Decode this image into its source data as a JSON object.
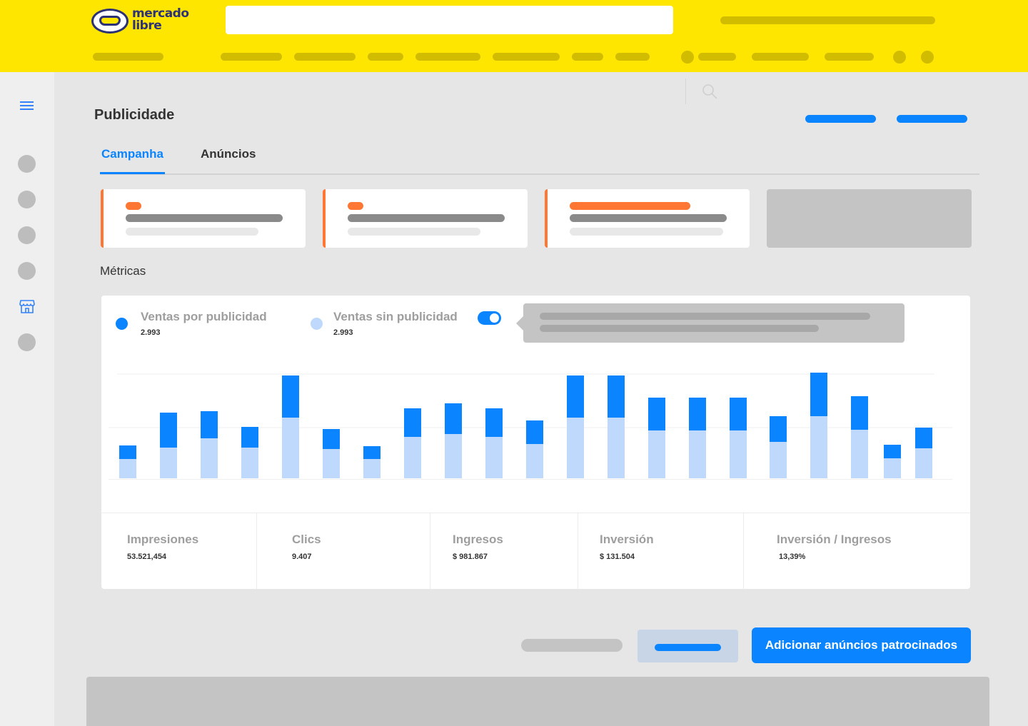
{
  "colors": {
    "brand_yellow": "#ffe600",
    "accent_blue": "#0a84ff",
    "light_blue": "#bfd9fc",
    "orange": "#ff7733",
    "placeholder_gray": "#c4c4c4"
  },
  "header": {
    "logo_text_line1": "mercado",
    "logo_text_line2": "libre",
    "logo_icon": "handshake-icon",
    "search": {
      "value": "",
      "placeholder": ""
    }
  },
  "sidebar": {
    "menu_icon": "menu-icon",
    "store_icon": "store-icon"
  },
  "page": {
    "title": "Publicidade",
    "search_icon": "search-icon"
  },
  "tabs": [
    {
      "label": "Campanha",
      "active": true
    },
    {
      "label": "Anúncios",
      "active": false
    }
  ],
  "metrics_section": {
    "label": "Métricas",
    "legend": [
      {
        "name": "Ventas por publicidad",
        "value": "2.993",
        "color": "#0a84ff"
      },
      {
        "name": "Ventas sin publicidad",
        "value": "2.993",
        "color": "#bfd9fc"
      }
    ],
    "toggle_on": true,
    "summary": [
      {
        "name": "Impresiones",
        "value": "53.521,454"
      },
      {
        "name": "Clics",
        "value": "9.407"
      },
      {
        "name": "Ingresos",
        "value": "$ 981.867"
      },
      {
        "name": "Inversión",
        "value": "$ 131.504"
      },
      {
        "name": "Inversión / Ingresos",
        "value": "13,39%"
      }
    ]
  },
  "chart_data": {
    "type": "bar",
    "stacked": true,
    "grid": true,
    "series": [
      {
        "name": "Ventas sin publicidad",
        "values": [
          27,
          43,
          56,
          43,
          85,
          41,
          27,
          58,
          62,
          58,
          48,
          85,
          85,
          67,
          67,
          67,
          51,
          87,
          68,
          28,
          42
        ]
      },
      {
        "name": "Ventas por publicidad",
        "values": [
          19,
          49,
          38,
          29,
          59,
          28,
          18,
          40,
          43,
          40,
          33,
          59,
          59,
          46,
          46,
          46,
          36,
          61,
          47,
          19,
          29
        ]
      }
    ]
  },
  "actions": {
    "primary_label": "Adicionar anúncios patrocinados"
  }
}
